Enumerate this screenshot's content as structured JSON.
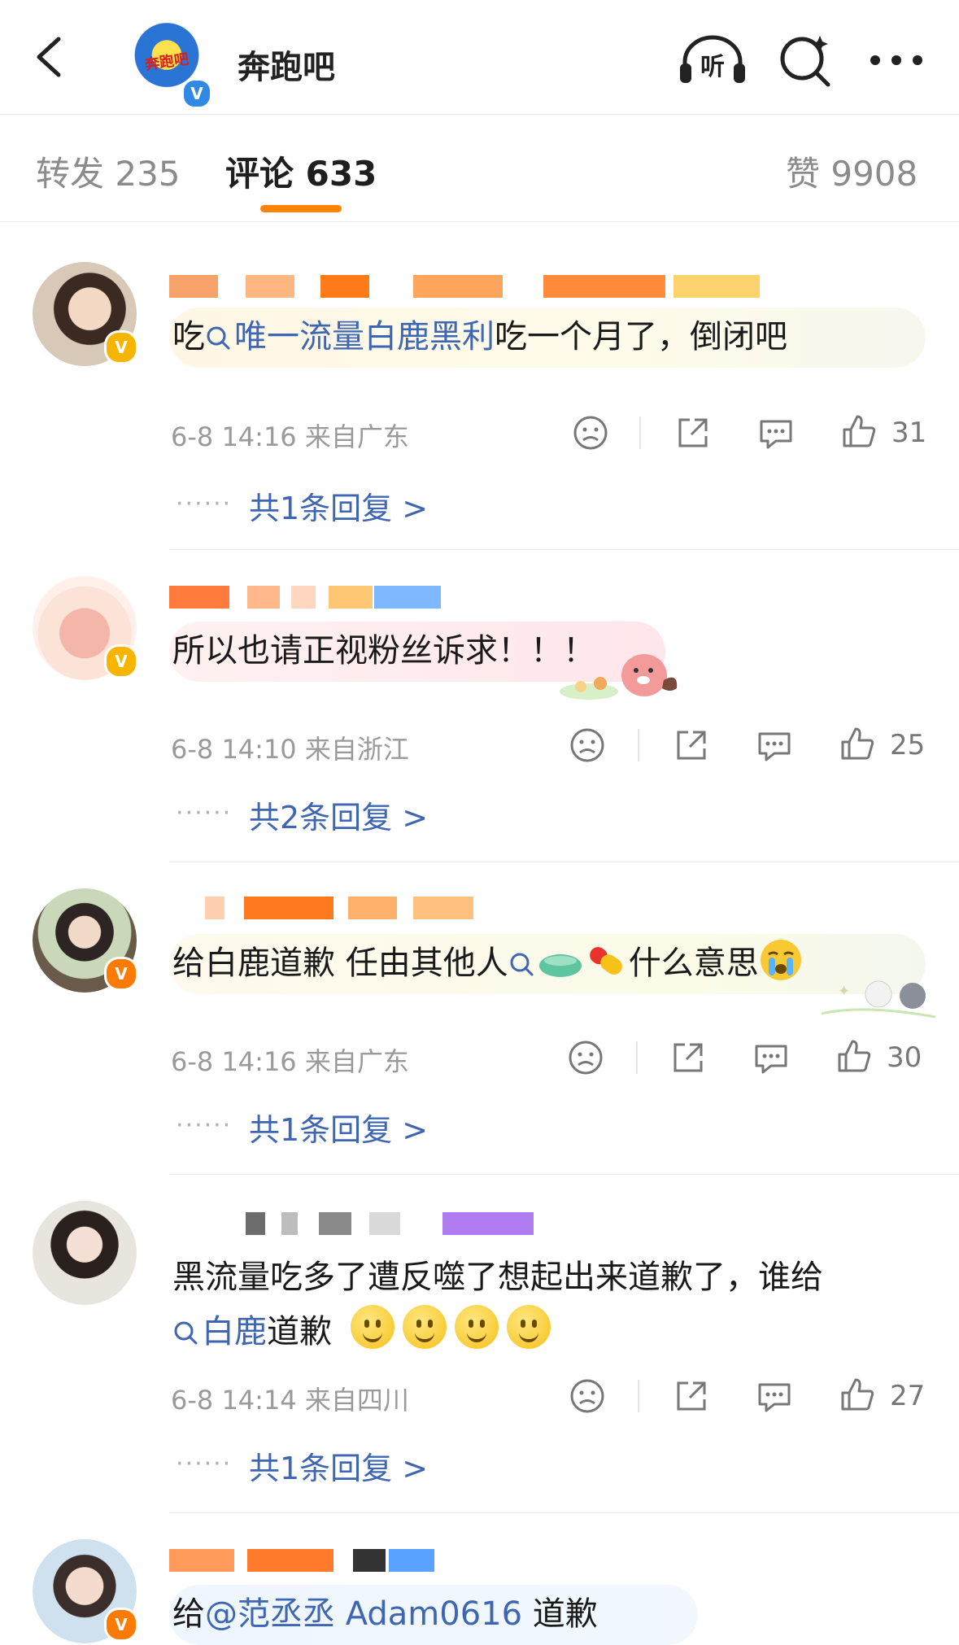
{
  "header": {
    "title": "奔跑吧",
    "logo_text": "奔跑吧",
    "icons": [
      "back-icon",
      "listen-icon",
      "search-icon",
      "more-icon"
    ]
  },
  "tabs": {
    "repost": "转发 235",
    "comments": "评论 633",
    "likes": "赞 9908"
  },
  "colors": {
    "accent": "#ff8200",
    "link": "#3e66b2",
    "muted": "#9a9a9a"
  },
  "comments": [
    {
      "text_prefix": "吃",
      "link": "唯一流量白鹿黑利",
      "text_suffix": "吃一个月了，倒闭吧",
      "time": "6-8 14:16 来自广东",
      "likes": "31",
      "replies": "共1条回复 >"
    },
    {
      "text": "所以也请正视粉丝诉求！！！",
      "time": "6-8 14:10 来自浙江",
      "likes": "25",
      "replies": "共2条回复 >"
    },
    {
      "text_prefix": "给白鹿道歉 任由其他人",
      "text_suffix": "什么意思",
      "time": "6-8 14:16 来自广东",
      "likes": "30",
      "replies": "共1条回复 >"
    },
    {
      "text_line1": "黑流量吃多了遭反噬了想起出来道歉了，谁给",
      "link": "白鹿",
      "text_line2": "道歉",
      "time": "6-8 14:14 来自四川",
      "likes": "27",
      "replies": "共1条回复 >"
    },
    {
      "text_prefix": "给",
      "mention": "@范丞丞 Adam0616",
      "text_suffix": " 道歉"
    }
  ],
  "reply_dots": "······"
}
